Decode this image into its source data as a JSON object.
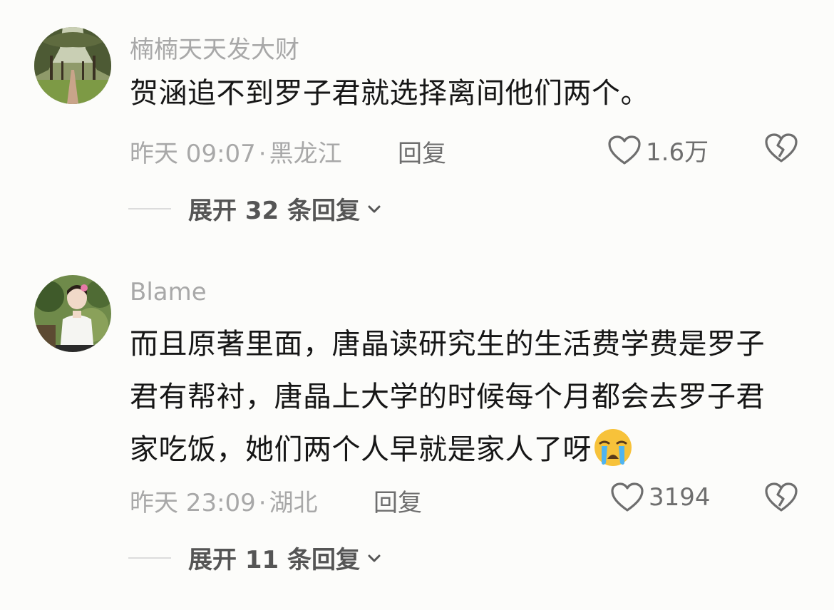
{
  "comments": [
    {
      "username": "楠楠天天发大财",
      "content": "贺涵追不到罗子君就选择离间他们两个。",
      "time": "昨天 09:07",
      "location": "黑龙江",
      "reply_label": "回复",
      "likes": "1.6万",
      "expand_label": "展开 32 条回复",
      "avatar_icon": "tree-avenue-avatar",
      "emoji": ""
    },
    {
      "username": "Blame",
      "content": "而且原著里面，唐晶读研究生的生活费学费是罗子君有帮衬，唐晶上大学的时候每个月都会去罗子君家吃饭，她们两个人早就是家人了呀",
      "time": "昨天 23:09",
      "location": "湖北",
      "reply_label": "回复",
      "likes": "3194",
      "expand_label": "展开 11 条回复",
      "avatar_icon": "person-portrait-avatar",
      "emoji": "crying-face-emoji"
    }
  ],
  "meta_separator": "·",
  "colors": {
    "background": "#fcfcfa",
    "text_primary": "#161616",
    "text_secondary": "#a8a8a8",
    "action_gray": "#6e6e6e"
  }
}
